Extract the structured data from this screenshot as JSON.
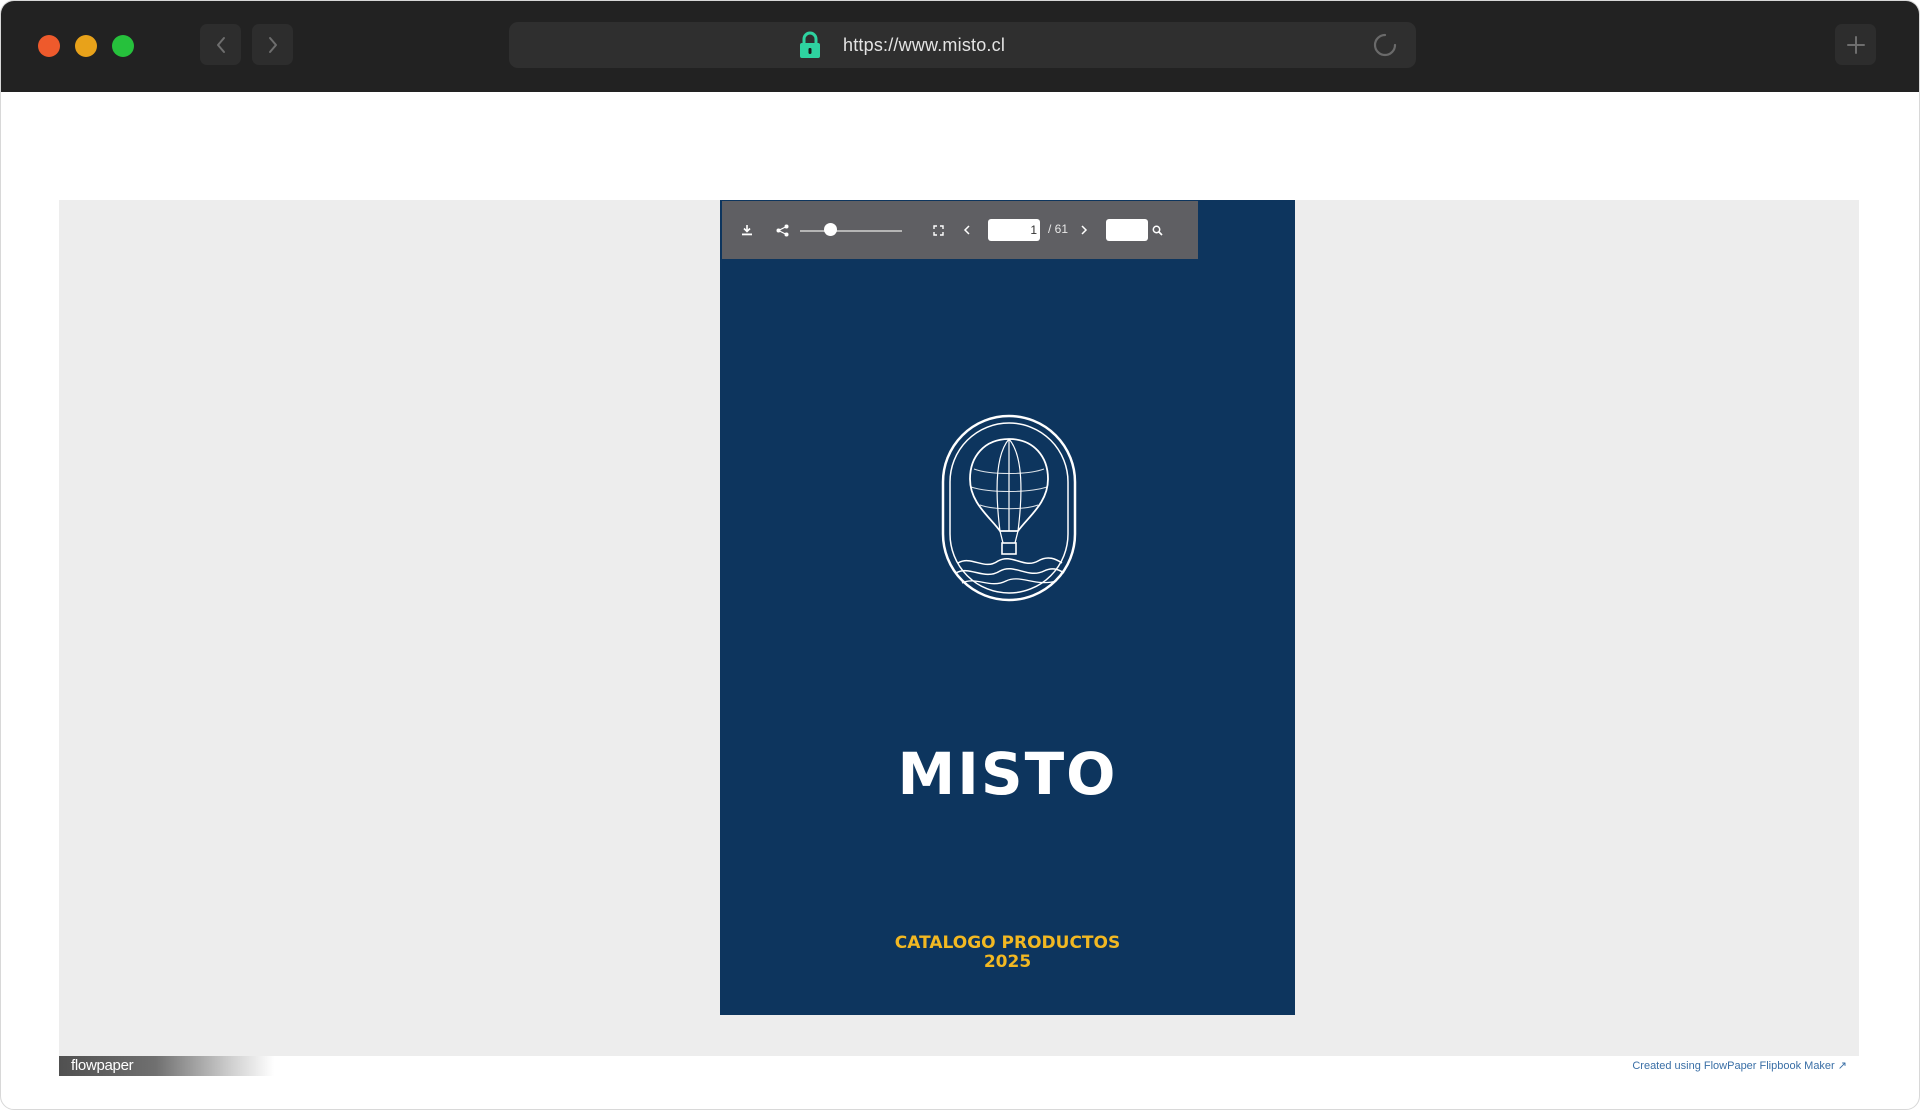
{
  "browser": {
    "url": "https://www.misto.cl",
    "icons": {
      "back": "chevron-left-icon",
      "forward": "chevron-right-icon",
      "lock": "lock-icon",
      "reload": "reload-icon",
      "new_tab": "plus-icon"
    },
    "colors": {
      "chrome": "#222222",
      "lock": "#2ed3a0"
    }
  },
  "viewer": {
    "toolbar": {
      "icons": [
        "download-icon",
        "share-icon",
        "zoom-slider",
        "fullscreen-icon",
        "chevron-left-icon",
        "chevron-right-icon",
        "search-icon"
      ],
      "current_page": "1",
      "total_pages": "/ 61",
      "search_value": "",
      "zoom_level": 0.3
    },
    "cover": {
      "brand": "MISTO",
      "title_line1": "CATALOGO PRODUCTOS",
      "title_line2": "2025",
      "emblem": "hot-air-balloon-emblem",
      "colors": {
        "background": "#0d355e",
        "brand": "#ffffff",
        "title": "#f2b822"
      }
    }
  },
  "footer": {
    "flowpaper_logo": "flowpaper",
    "credit": "Created using FlowPaper Flipbook Maker ↗"
  }
}
